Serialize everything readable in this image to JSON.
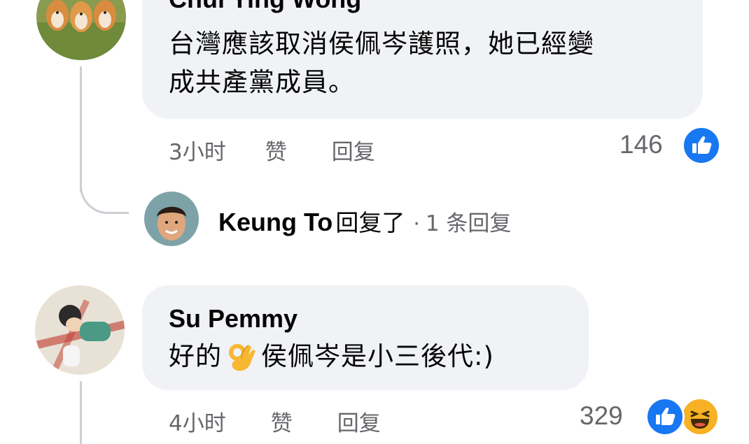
{
  "comments": [
    {
      "author": "Chui Ying Wong",
      "text_line1": "台灣應該取消侯佩岑護照，她已經變",
      "text_line2": "成共產黨成員。",
      "time": "3小时",
      "like_label": "赞",
      "reply_label": "回复",
      "reaction_count": "146",
      "reactions": [
        "like-icon"
      ]
    },
    {
      "author": "Su Pemmy",
      "text_before_emoji": "好的",
      "emoji": "ok-hand-emoji",
      "text_after_emoji": "侯佩岑是小三後代:)",
      "time": "4小时",
      "like_label": "赞",
      "reply_label": "回复",
      "reaction_count": "329",
      "reactions": [
        "like-icon",
        "haha-icon"
      ]
    }
  ],
  "reply_summary": {
    "name": "Keung To",
    "verb": "回复了",
    "separator": "·",
    "count_text": "1 条回复"
  },
  "colors": {
    "bubble": "#f0f2f5",
    "secondary_text": "#65676b",
    "like_blue": "#1877f2",
    "haha_yellow": "#f7b125",
    "thread_line": "#ccd0d5"
  }
}
